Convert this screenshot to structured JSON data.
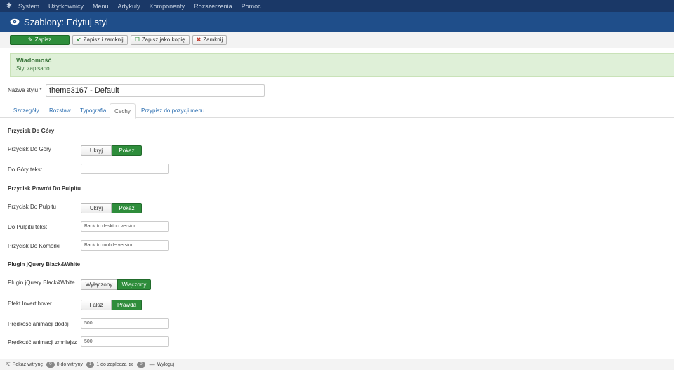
{
  "topnav": {
    "items": [
      "System",
      "Użytkownicy",
      "Menu",
      "Artykuły",
      "Komponenty",
      "Rozszerzenia",
      "Pomoc"
    ]
  },
  "header": {
    "title": "Szablony: Edytuj styl"
  },
  "toolbar": {
    "save": "Zapisz",
    "save_close": "Zapisz i zamknij",
    "save_copy": "Zapisz jako kopię",
    "close": "Zamknij"
  },
  "message": {
    "title": "Wiadomość",
    "text": "Styl zapisano"
  },
  "style_name": {
    "label": "Nazwa stylu *",
    "value": "theme3167 - Default"
  },
  "tabs": [
    "Szczegóły",
    "Rozstaw",
    "Typografia",
    "Cechy",
    "Przypisz do pozycji menu"
  ],
  "active_tab": "Cechy",
  "sections": {
    "top_button": {
      "title": "Przycisk Do Góry",
      "toggle_label": "Przycisk Do Góry",
      "off": "Ukryj",
      "on": "Pokaż",
      "text_label": "Do Góry tekst",
      "text_value": ""
    },
    "desktop": {
      "title": "Przycisk Powrót Do Pulpitu",
      "toggle_label": "Przycisk Do Pulpitu",
      "off": "Ukryj",
      "on": "Pokaż",
      "desktop_label": "Do Pulpitu tekst",
      "desktop_value": "Back to desktop version",
      "mobile_label": "Przycisk Do Komórki",
      "mobile_value": "Back to mobile version"
    },
    "bw": {
      "title": "Plugin jQuery Black&White",
      "plugin_label": "Plugin jQuery Black&White",
      "plugin_off": "Wyłączony",
      "plugin_on": "Włączony",
      "invert_label": "Efekt Invert hover",
      "invert_off": "Fałsz",
      "invert_on": "Prawda",
      "speed_add_label": "Prędkość animacji dodaj",
      "speed_add_value": "500",
      "speed_sub_label": "Prędkość animacji zmniejsz",
      "speed_sub_value": "500"
    }
  },
  "statusbar": {
    "view_site": "Pokaż witrynę",
    "visitors_count": "0",
    "visitors_label": "0 do witryny",
    "backend_count": "1",
    "backend_label": "1 do zaplecza",
    "messages_count": "0",
    "logout": "Wyloguj"
  },
  "colors": {
    "topnav_bg": "#1a3867",
    "header_bg": "#1f4e8a",
    "primary_green": "#2e8d3b",
    "message_bg": "#dff0d8",
    "link_blue": "#2a6db0"
  }
}
